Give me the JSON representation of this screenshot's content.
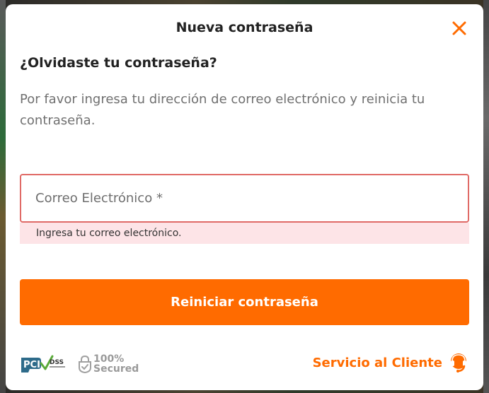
{
  "modal": {
    "title": "Nueva contraseña",
    "heading": "¿Olvidaste tu contraseña?",
    "description": "Por favor ingresa tu dirección de correo electrónico y reinicia tu contraseña.",
    "email": {
      "placeholder": "Correo Electrónico *",
      "value": "",
      "error": "Ingresa tu correo electrónico."
    },
    "reset_button_label": "Reiniciar contraseña"
  },
  "footer": {
    "pci_badge_text": "PCI DSS",
    "secured_percent": "100%",
    "secured_label": "Secured",
    "customer_service_label": "Servicio al Cliente"
  },
  "colors": {
    "accent": "#ff6b00",
    "error_border": "#e06a66",
    "error_background": "#fde4e7",
    "title_text": "#222222",
    "body_text": "#707070"
  },
  "icons": {
    "close": "close-icon",
    "pci": "pci-dss-icon",
    "secured": "shield-check-icon",
    "customer_service": "headset-icon"
  }
}
